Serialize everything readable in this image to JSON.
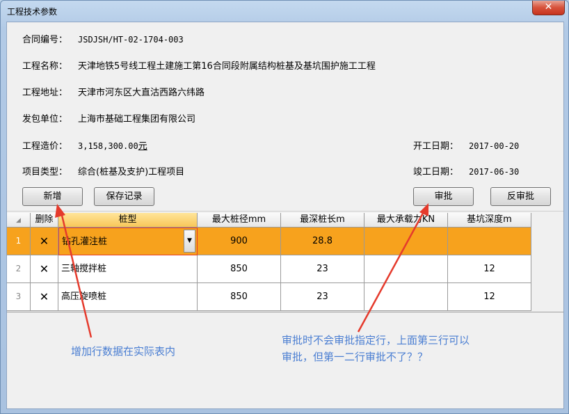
{
  "window": {
    "title": "工程技术参数",
    "close_glyph": "✕"
  },
  "info": {
    "contract_label": "合同编号：",
    "contract_value": "JSDJSH/HT-02-1704-003",
    "name_label": "工程名称：",
    "name_value": "天津地铁5号线工程土建施工第16合同段附属结构桩基及基坑围护施工工程",
    "address_label": "工程地址：",
    "address_value": "天津市河东区大直沽西路六纬路",
    "client_label": "发包单位：",
    "client_value": "上海市基础工程集团有限公司",
    "cost_label": "工程造价：",
    "cost_value": "3,158,300.00",
    "cost_unit": "元",
    "type_label": "项目类型：",
    "type_value": "综合(桩基及支护)工程项目",
    "start_label": "开工日期：",
    "start_value": "2017-00-20",
    "end_label": "竣工日期：",
    "end_value": "2017-06-30"
  },
  "buttons": {
    "add": "新增",
    "save": "保存记录",
    "approve": "审批",
    "unapprove": "反审批"
  },
  "grid": {
    "headers": [
      "删除",
      "桩型",
      "最大桩径mm",
      "最深桩长m",
      "最大承载力KN",
      "基坑深度m"
    ],
    "delete_glyph": "✕",
    "dropdown_glyph": "▼",
    "rows": [
      {
        "num": "1",
        "type": "钻孔灌注桩",
        "dia": "900",
        "len": "28.8",
        "load": "",
        "depth": ""
      },
      {
        "num": "2",
        "type": "三轴搅拌桩",
        "dia": "850",
        "len": "23",
        "load": "",
        "depth": "12"
      },
      {
        "num": "3",
        "type": "高压旋喷桩",
        "dia": "850",
        "len": "23",
        "load": "",
        "depth": "12"
      }
    ]
  },
  "annotations": {
    "left": "增加行数据在实际表内",
    "right_line1": "审批时不会审批指定行，上面第三行可以",
    "right_line2": "审批，但第一二行审批不了？？"
  },
  "colors": {
    "selected_row": "#f7a21d",
    "annotation": "#4a7ed2",
    "arrow": "#e53a2c"
  }
}
